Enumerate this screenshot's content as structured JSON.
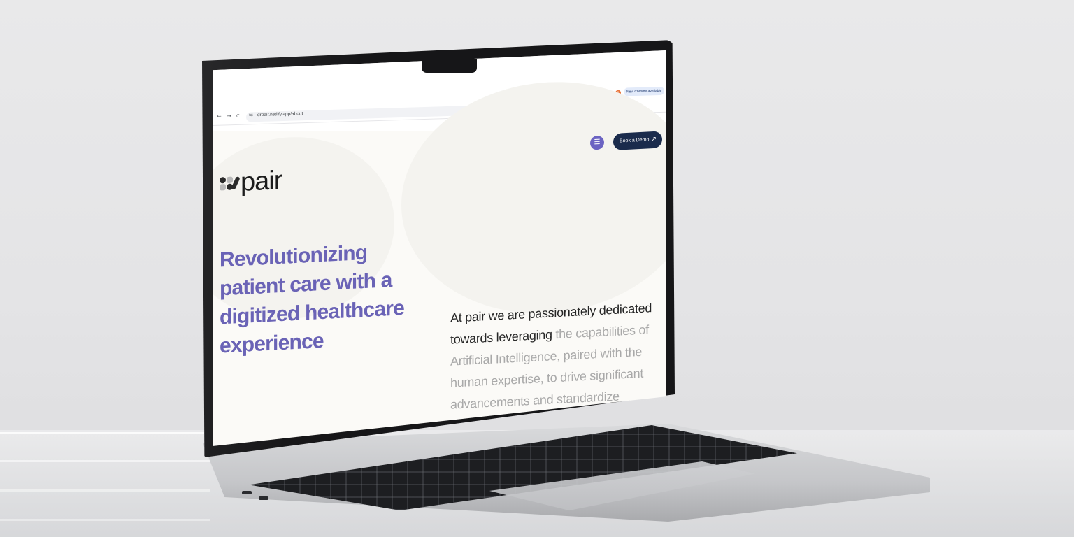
{
  "browser": {
    "url": "drpair.netlify.app/about",
    "back_icon": "←",
    "forward_icon": "→",
    "reload_icon": "C",
    "tune_icon": "⇆",
    "star_icon": "☆",
    "extension_badge": "1",
    "update_chip": "New Chrome available"
  },
  "site": {
    "logo_text": "pair",
    "menu_icon": "☰",
    "demo_button": "Book a Demo",
    "demo_arrow": "↗",
    "headline": "Revolutionizing patient care with a digitized healthcare experience",
    "about_dark": "At pair we are passionately dedicated towards leveraging",
    "about_light": " the capabilities of Artificial Intelligence, paired with the human expertise, to drive significant advancements and standardize"
  },
  "colors": {
    "accent": "#6a63b6",
    "button_dark": "#1a2b4c",
    "menu_button": "#6b63c2",
    "page_bg": "#fbfaf7"
  }
}
